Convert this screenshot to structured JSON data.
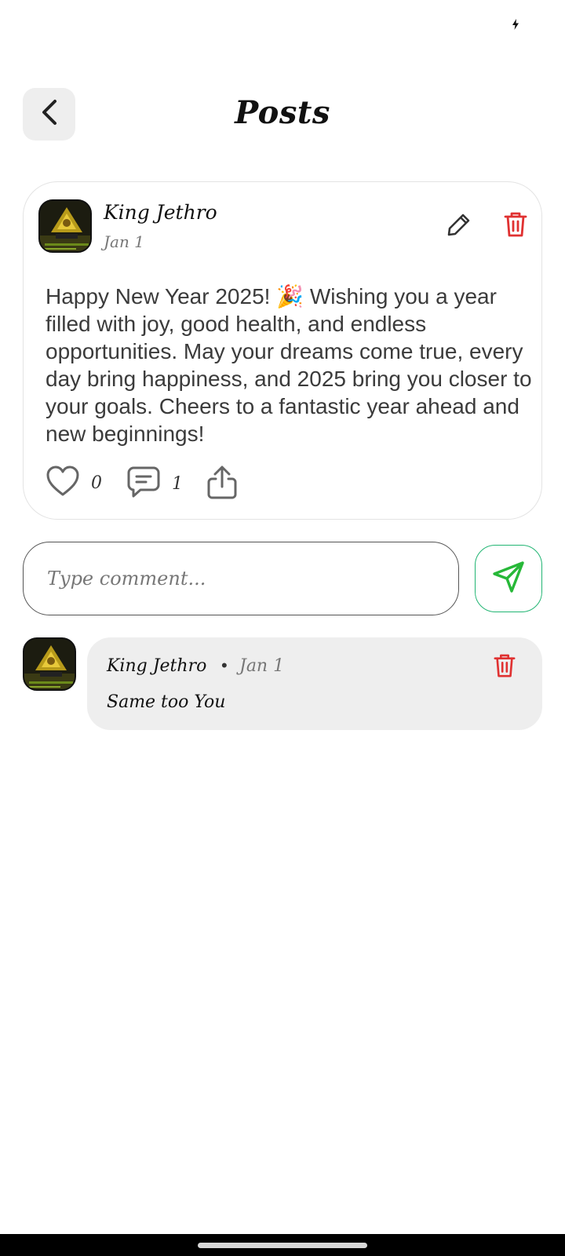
{
  "header": {
    "title": "Posts",
    "back_icon": "chevron-left-icon"
  },
  "post": {
    "author": "King Jethro",
    "date": "Jan 1",
    "body": "Happy New Year 2025! 🎉 Wishing you a year filled with joy, good health, and endless opportunities. May your dreams come true, every day bring happiness, and 2025 bring you closer to your goals. Cheers to a fantastic year ahead and new beginnings!",
    "likes": "0",
    "comments": "1",
    "edit_icon": "pencil-icon",
    "delete_icon": "trash-icon",
    "like_icon": "heart-icon",
    "comment_icon": "comment-icon",
    "share_icon": "share-icon"
  },
  "comment_input": {
    "placeholder": "Type comment...",
    "send_icon": "send-icon"
  },
  "comments": [
    {
      "author": "King Jethro",
      "date": "Jan 1",
      "text": "Same too You"
    }
  ],
  "colors": {
    "delete": "#e03131",
    "send": "#22b573",
    "accent_border": "#22b573"
  }
}
